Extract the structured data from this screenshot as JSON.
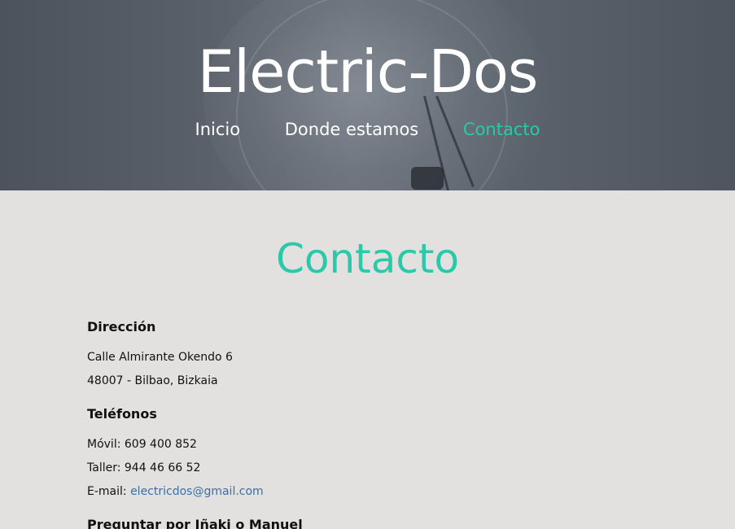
{
  "header": {
    "title": "Electric-Dos",
    "nav": {
      "home": "Inicio",
      "location": "Donde estamos",
      "contact": "Contacto"
    }
  },
  "main": {
    "heading": "Contacto",
    "address": {
      "heading": "Dirección",
      "line1": "Calle Almirante Okendo 6",
      "line2": "48007 - Bilbao, Bizkaia"
    },
    "phones": {
      "heading": "Teléfonos",
      "mobile": "Móvil: 609 400 852",
      "workshop": "Taller: 944 46 66 52",
      "email_label": "E-mail: ",
      "email": "electricdos@gmail.com"
    },
    "ask_for": "Preguntar por Iñaki o Manuel"
  },
  "colors": {
    "accent": "#2bc8a9",
    "link": "#3c6ea5",
    "background": "#e2e1e0"
  }
}
